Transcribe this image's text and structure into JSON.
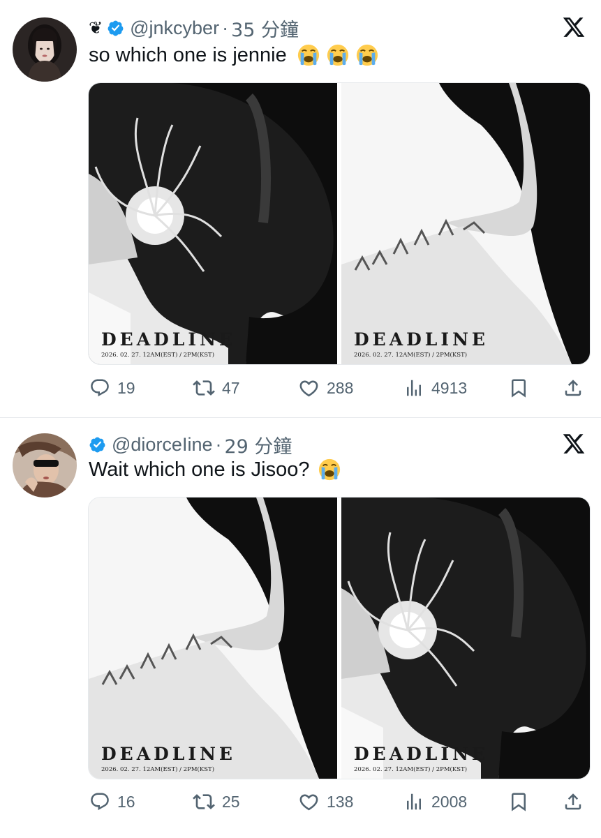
{
  "tweets": [
    {
      "ornament": "❦",
      "handle": "@jnkcyber",
      "separator": "·",
      "time": "35 分鐘",
      "text": "so which one is jennie",
      "emoji_count": 3,
      "media": [
        {
          "title": "DEADLINE",
          "date": "2026. 02. 27. 12AM(EST) / 2PM(KST)",
          "variant": "ear-flower"
        },
        {
          "title": "DEADLINE",
          "date": "2026. 02. 27. 12AM(EST) / 2PM(KST)",
          "variant": "shoulder-chain"
        }
      ],
      "stats": {
        "replies": "19",
        "reposts": "47",
        "likes": "288",
        "views": "4913"
      }
    },
    {
      "ornament": "",
      "handle": "@diorceIine",
      "separator": "·",
      "time": "29 分鐘",
      "text": "Wait which one is Jisoo?",
      "emoji_count": 1,
      "media": [
        {
          "title": "DEADLINE",
          "date": "2026. 02. 27. 12AM(EST) / 2PM(KST)",
          "variant": "shoulder-chain"
        },
        {
          "title": "DEADLINE",
          "date": "2026. 02. 27. 12AM(EST) / 2PM(KST)",
          "variant": "ear-flower"
        }
      ],
      "stats": {
        "replies": "16",
        "reposts": "25",
        "likes": "138",
        "views": "2008"
      }
    }
  ],
  "icons": {
    "verified": "verified-badge-icon",
    "x_logo": "x-logo-icon",
    "reply": "reply-icon",
    "repost": "repost-icon",
    "like": "heart-icon",
    "views": "views-icon",
    "bookmark": "bookmark-icon",
    "share": "share-icon",
    "emoji": "loudly-crying-face-emoji"
  },
  "colors": {
    "verified": "#1d9bf0",
    "muted": "#536471",
    "text": "#0f1419"
  }
}
